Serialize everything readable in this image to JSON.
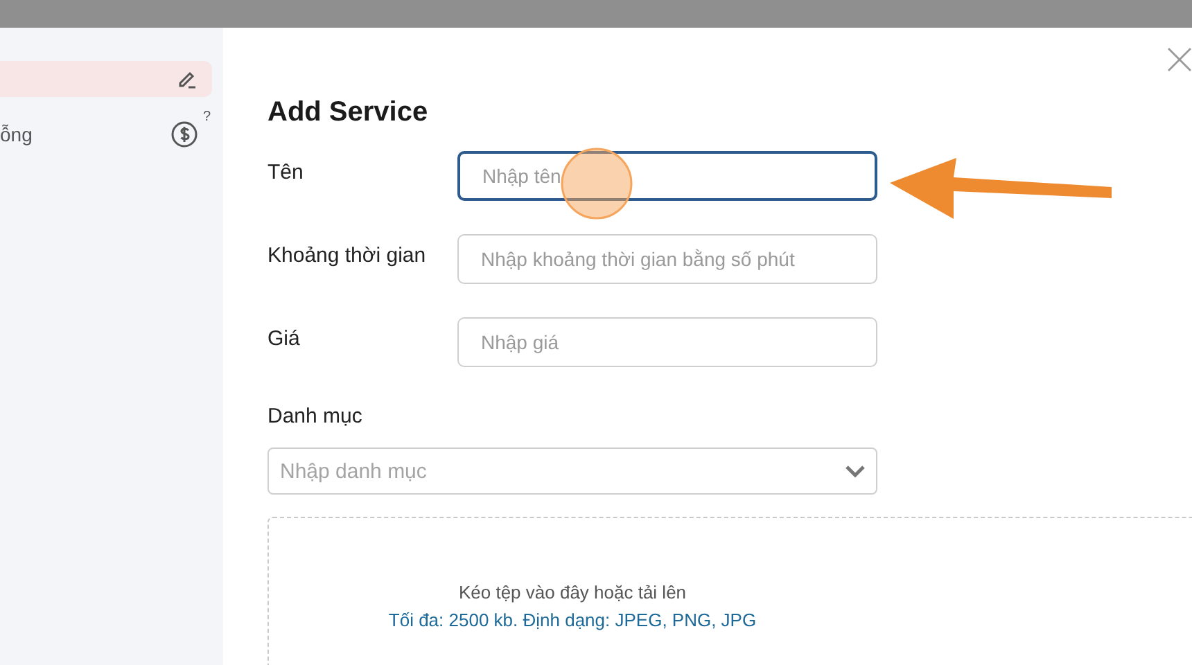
{
  "sidebar": {
    "items": [
      {
        "kind": "edit",
        "selected": true
      },
      {
        "kind": "price",
        "label": "ỗng",
        "badge": "?",
        "selected": false
      }
    ]
  },
  "dialog": {
    "title": "Add Service",
    "fields": [
      {
        "kind": "text",
        "label": "Tên",
        "placeholder": "Nhập tên",
        "focused": true
      },
      {
        "kind": "text",
        "label": "Khoảng thời gian",
        "placeholder": "Nhập khoảng thời gian bằng số phút",
        "focused": false
      },
      {
        "kind": "text",
        "label": "Giá",
        "placeholder": "Nhập giá",
        "focused": false
      },
      {
        "kind": "select",
        "label": "Danh mục",
        "placeholder": "Nhập danh mục",
        "focused": false
      }
    ],
    "upload": {
      "prompt": "Kéo tệp vào đây hoặc tải lên",
      "hint": "Tối đa: 2500 kb. Định dạng: JPEG, PNG, JPG"
    }
  }
}
